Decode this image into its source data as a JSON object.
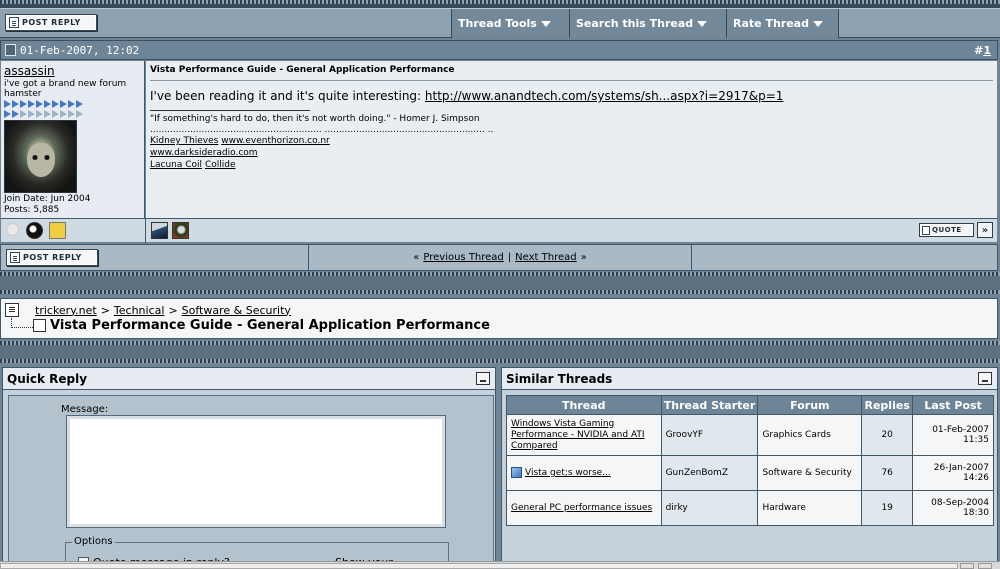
{
  "toolbar": {
    "post_reply": "POST REPLY",
    "thread_tools": "Thread Tools",
    "search_thread": "Search this Thread",
    "rate_thread": "Rate Thread"
  },
  "post": {
    "date": "01-Feb-2007, 12:02",
    "number": "1",
    "title": "Vista Performance Guide - General Application Performance",
    "text": "I've been reading it and it's quite interesting: ",
    "link": "http://www.anandtech.com/systems/sh...aspx?i=2917&p=1",
    "quote_label": "QUOTE"
  },
  "user": {
    "name": "assassin",
    "title": "i've got a brand new forum hamster",
    "join_date": "Join Date: Jun 2004",
    "posts": "Posts: 5,885"
  },
  "signature": {
    "quote": "\"If something's hard to do, then it's not worth doing.\" - Homer J. Simpson",
    "dots": "............................................................ ........................................................ ..",
    "line1_a": "Kidney Thieves",
    "line1_b": "www.eventhorizon.co.nr",
    "line2": "www.darksideradio.com",
    "line3_a": "Lacuna Coil",
    "line3_b": "Collide"
  },
  "nav": {
    "prev": "Previous Thread",
    "sep": "|",
    "next": "Next Thread",
    "left_arrow": "«",
    "right_arrow": "»"
  },
  "breadcrumb": {
    "site": "trickery.net",
    "cat": "Technical",
    "forum": "Software & Security",
    "sep": ">",
    "thread": "Vista Performance Guide - General Application Performance"
  },
  "quick_reply": {
    "title": "Quick Reply",
    "message_label": "Message:",
    "options_label": "Options",
    "opt_quote": "Quote message in reply?",
    "opt_sig": "Show your signature",
    "opt_sig_checked": "✓"
  },
  "similar": {
    "title": "Similar Threads",
    "headers": [
      "Thread",
      "Thread Starter",
      "Forum",
      "Replies",
      "Last Post"
    ],
    "rows": [
      {
        "thread": "Windows Vista Gaming Performance - NVIDIA and ATI Compared",
        "starter": "GroovYF",
        "forum": "Graphics Cards",
        "replies": "20",
        "date": "01-Feb-2007",
        "time": "11:35"
      },
      {
        "thread": "Vista get;s worse...",
        "starter": "GunZenBomZ",
        "forum": "Software & Security",
        "replies": "76",
        "date": "26-Jan-2007",
        "time": "14:26"
      },
      {
        "thread": "General PC performance issues",
        "starter": "dirky",
        "forum": "Hardware",
        "replies": "19",
        "date": "08-Sep-2004",
        "time": "18:30"
      }
    ]
  }
}
